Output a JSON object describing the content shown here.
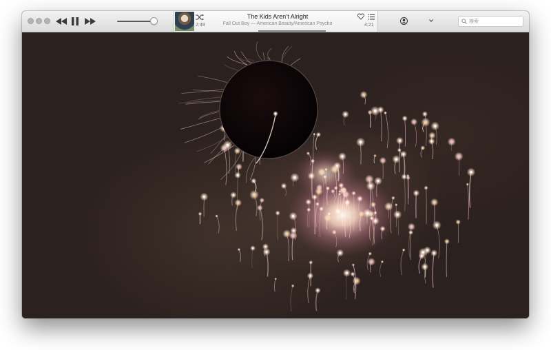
{
  "toolbar": {
    "window_controls": [
      "close",
      "minimize",
      "zoom"
    ],
    "playback": {
      "rewind_icon": "rewind-icon",
      "pause_icon": "pause-icon",
      "forward_icon": "fast-forward-icon"
    },
    "volume_level": 0.9
  },
  "now_playing": {
    "title": "The Kids Aren’t Alright",
    "subtitle": "Fall Out Boy — American Beauty/American Psycho",
    "elapsed": "2:49",
    "remaining": "4:21",
    "progress": 0.4
  },
  "search": {
    "placeholder": "検索",
    "value": ""
  },
  "colors": {
    "toolbar_top": "#f3f2f2",
    "toolbar_bottom": "#dcdbdb",
    "visualizer_bg": "#2b211e",
    "orb": "#0c0506",
    "particle": "#ffe6d2"
  }
}
